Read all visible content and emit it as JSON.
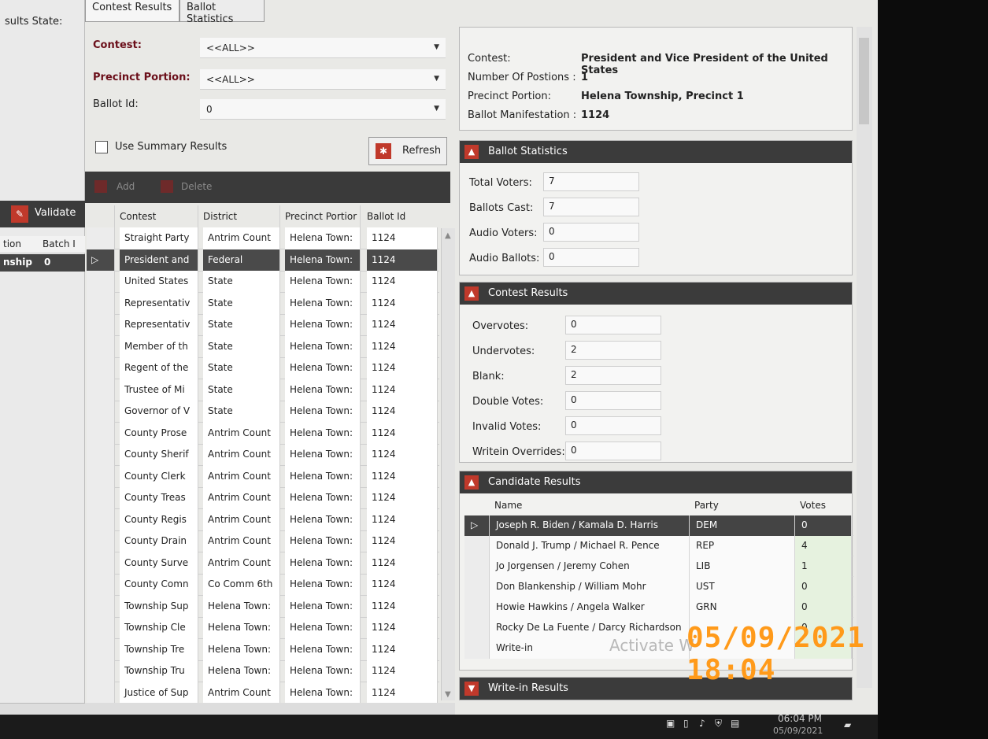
{
  "left": {
    "results_state_label": "sults State:",
    "validate_label": "Validate",
    "columns": [
      "tion",
      "Batch I"
    ],
    "selected_row": [
      "nship",
      "0"
    ]
  },
  "tabs": [
    "Contest Results",
    "Ballot Statistics"
  ],
  "filters": {
    "contest_label": "Contest:",
    "contest_value": "<<ALL>>",
    "precinct_label": "Precinct Portion:",
    "precinct_value": "<<ALL>>",
    "ballot_label": "Ballot Id:",
    "ballot_value": "0",
    "summary_label": "Use Summary Results",
    "refresh_label": "Refresh"
  },
  "toolbar": {
    "add": "Add",
    "delete": "Delete"
  },
  "grid": {
    "columns": [
      "Contest",
      "District",
      "Precinct Portior",
      "Ballot Id"
    ],
    "rows": [
      [
        "Straight Party",
        "Antrim Count",
        "Helena Town:",
        "1124"
      ],
      [
        "President and",
        "Federal",
        "Helena Town:",
        "1124"
      ],
      [
        "United States",
        "State",
        "Helena Town:",
        "1124"
      ],
      [
        "Representativ",
        "State",
        "Helena Town:",
        "1124"
      ],
      [
        "Representativ",
        "State",
        "Helena Town:",
        "1124"
      ],
      [
        "Member of th",
        "State",
        "Helena Town:",
        "1124"
      ],
      [
        "Regent of the",
        "State",
        "Helena Town:",
        "1124"
      ],
      [
        "Trustee of Mi",
        "State",
        "Helena Town:",
        "1124"
      ],
      [
        "Governor of V",
        "State",
        "Helena Town:",
        "1124"
      ],
      [
        "County Prose",
        "Antrim Count",
        "Helena Town:",
        "1124"
      ],
      [
        "County Sherif",
        "Antrim Count",
        "Helena Town:",
        "1124"
      ],
      [
        "County Clerk",
        "Antrim Count",
        "Helena Town:",
        "1124"
      ],
      [
        "County Treas",
        "Antrim Count",
        "Helena Town:",
        "1124"
      ],
      [
        "County Regis",
        "Antrim Count",
        "Helena Town:",
        "1124"
      ],
      [
        "County Drain",
        "Antrim Count",
        "Helena Town:",
        "1124"
      ],
      [
        "County Surve",
        "Antrim Count",
        "Helena Town:",
        "1124"
      ],
      [
        "County Comn",
        "Co Comm 6th",
        "Helena Town:",
        "1124"
      ],
      [
        "Township Sup",
        "Helena Town:",
        "Helena Town:",
        "1124"
      ],
      [
        "Township Cle",
        "Helena Town:",
        "Helena Town:",
        "1124"
      ],
      [
        "Township Tre",
        "Helena Town:",
        "Helena Town:",
        "1124"
      ],
      [
        "Township Tru",
        "Helena Town:",
        "Helena Town:",
        "1124"
      ],
      [
        "Justice of Sup",
        "Antrim Count",
        "Helena Town:",
        "1124"
      ]
    ]
  },
  "description": {
    "contest_label": "Contest:",
    "contest_value": "President and Vice President of the United States",
    "positions_label": "Number Of Postions :",
    "positions_value": "1",
    "precinct_label": "Precinct Portion:",
    "precinct_value": "Helena Township, Precinct 1",
    "manifestation_label": "Ballot Manifestation :",
    "manifestation_value": "1124"
  },
  "ballot_stats": {
    "title": "Ballot Statistics",
    "total_voters_label": "Total Voters:",
    "total_voters": "7",
    "ballots_cast_label": "Ballots Cast:",
    "ballots_cast": "7",
    "audio_voters_label": "Audio Voters:",
    "audio_voters": "0",
    "audio_ballots_label": "Audio Ballots:",
    "audio_ballots": "0"
  },
  "contest_results": {
    "title": "Contest Results",
    "overvotes_label": "Overvotes:",
    "overvotes": "0",
    "undervotes_label": "Undervotes:",
    "undervotes": "2",
    "blank_label": "Blank:",
    "blank": "2",
    "double_label": "Double Votes:",
    "double": "0",
    "invalid_label": "Invalid Votes:",
    "invalid": "0",
    "writein_label": "Writein Overrides:",
    "writein": "0"
  },
  "candidates": {
    "title": "Candidate Results",
    "columns": [
      "Name",
      "Party",
      "Votes"
    ],
    "rows": [
      [
        "Joseph R. Biden / Kamala D. Harris",
        "DEM",
        "0"
      ],
      [
        "Donald J. Trump / Michael R. Pence",
        "REP",
        "4"
      ],
      [
        "Jo Jorgensen / Jeremy Cohen",
        "LIB",
        "1"
      ],
      [
        "Don Blankenship / William Mohr",
        "UST",
        "0"
      ],
      [
        "Howie Hawkins / Angela Walker",
        "GRN",
        "0"
      ],
      [
        "Rocky De La Fuente / Darcy Richardson",
        "",
        "0"
      ],
      [
        "Write-in",
        "",
        ""
      ]
    ]
  },
  "writein_results": {
    "title": "Write-in Results"
  },
  "overlay": {
    "watermark": "Activate W",
    "datestamp": "05/09/2021  18:04"
  },
  "taskbar": {
    "time": "06:04 PM",
    "date": "05/09/2021"
  }
}
